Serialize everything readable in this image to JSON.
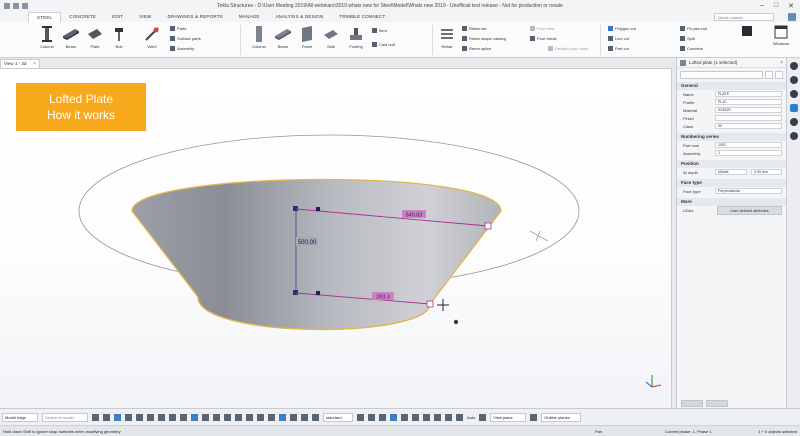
{
  "window": {
    "title": "Tekla Structures - D:\\User Meeting 2019\\All webinars\\2019 whats new for Steel\\Model\\Whats new 2019 - Unofficial test release - Not for production or resale"
  },
  "ribbon": {
    "tabs": [
      {
        "label": "STEEL",
        "active": true
      },
      {
        "label": "CONCRETE"
      },
      {
        "label": "EDIT"
      },
      {
        "label": "VIEW"
      },
      {
        "label": "DRAWINGS & REPORTS"
      },
      {
        "label": "MANAGE"
      },
      {
        "label": "ANALYSIS & DESIGN"
      },
      {
        "label": "TRIMBLE CONNECT"
      }
    ],
    "quick_launch_placeholder": "Quick Launch",
    "steel_buttons": [
      "Column",
      "Beam",
      "Plate",
      "Bolt",
      "Weld"
    ],
    "steel_small": [
      "Parts",
      "Surface parts",
      "Assembly"
    ],
    "concrete_buttons": [
      "Column",
      "Beam",
      "Panel",
      "Slab",
      "Footing"
    ],
    "concrete_small": [
      "Item",
      "Cast unit"
    ],
    "rebar_buttons": [
      "Rebar"
    ],
    "rebar_small": [
      "Rebar set",
      "Rebar shape catalog",
      "Rebar splice"
    ],
    "pour_small": [
      "Pour view",
      "Pour break",
      "Detailed pour units"
    ],
    "cut_small": [
      "Polygon cut",
      "Line cut",
      "Part cut"
    ],
    "edit_small": [
      "Fit part end",
      "Split",
      "Combine"
    ],
    "windows_label": "Windows"
  },
  "view": {
    "tab_label": "View 1 - 3d"
  },
  "callout": {
    "line1": "Lofted Plate",
    "line2": "How it works"
  },
  "dimensions": {
    "vertical": "500.00",
    "top": "849.83",
    "bottom": "283.3"
  },
  "properties": {
    "title": "Lofted plate (1 selected)",
    "general_header": "General",
    "rows_general": [
      {
        "label": "Name",
        "value": "PLATE"
      },
      {
        "label": "Profile",
        "value": "PL10"
      },
      {
        "label": "Material",
        "value": "S235JR"
      },
      {
        "label": "Finish",
        "value": ""
      },
      {
        "label": "Class",
        "value": "99"
      }
    ],
    "numbering_header": "Numbering series",
    "rows_numbering": [
      {
        "label": "Part num",
        "value": "1001"
      },
      {
        "label": "Assembly",
        "value": "1"
      }
    ],
    "position_header": "Position",
    "rows_position": [
      {
        "label": "At depth",
        "value": "Middle"
      }
    ],
    "position_offset": "0.00 mm",
    "face_header": "Face type",
    "rows_face": [
      {
        "label": "Face type",
        "value": "Perpendicular"
      }
    ],
    "more_header": "More",
    "udas_label": "UDAs",
    "udas_button": "User-defined attributes"
  },
  "bottombar": {
    "snap_mode": "Model edge",
    "search_placeholder": "Search in model",
    "standard": "standard",
    "auto_label": "Auto",
    "view_plane": "View plane",
    "outline_planes": "Outline planes"
  },
  "statusbar": {
    "hint": "Hold down Shift to ignore snap switches when modifying geometry",
    "pan": "Pan",
    "phase": "Current phase: 1, Phase 1",
    "selection": "1 + 0 objects selected"
  }
}
